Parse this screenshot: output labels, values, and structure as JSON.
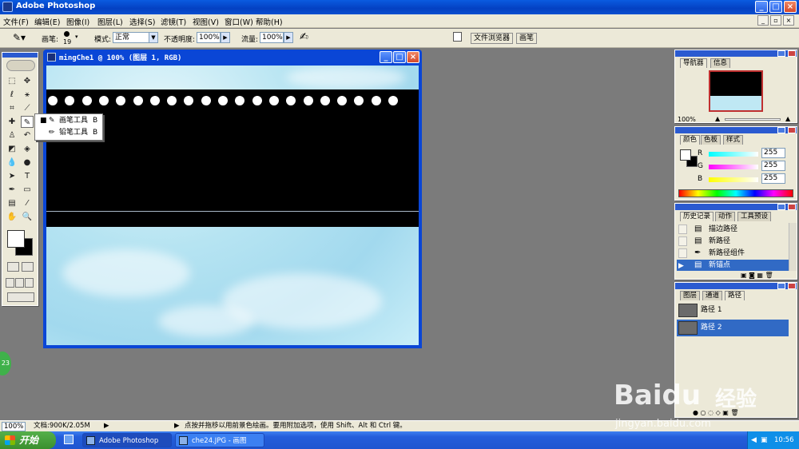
{
  "app": {
    "title": "Adobe Photoshop",
    "window_controls": {
      "minimize": "_",
      "maximize": "□",
      "close": "×"
    }
  },
  "menu": [
    "文件(F)",
    "编辑(E)",
    "图像(I)",
    "图层(L)",
    "选择(S)",
    "滤镜(T)",
    "视图(V)",
    "窗口(W)",
    "帮助(H)"
  ],
  "options_bar": {
    "brush_label": "画笔:",
    "brush_size": "19",
    "mode_label": "模式:",
    "mode_value": "正常",
    "opacity_label": "不透明度:",
    "opacity_value": "100%",
    "flow_label": "流量:",
    "flow_value": "100%",
    "tab_file_browser": "文件浏览器",
    "tab_brushes": "画笔"
  },
  "document": {
    "title": "mingChe1 @ 100% (图层 1, RGB)",
    "dot_count": 21
  },
  "tool_flyout": [
    {
      "name": "画笔工具",
      "key": "B",
      "bullet": "■",
      "selected": true
    },
    {
      "name": "铅笔工具",
      "key": "B",
      "bullet": "",
      "selected": false
    }
  ],
  "navigator_palette": {
    "tabs": [
      "导航器",
      "信息"
    ],
    "zoom": "100%"
  },
  "color_palette": {
    "tabs": [
      "颜色",
      "色板",
      "样式"
    ],
    "channels": [
      {
        "label": "R",
        "value": "255"
      },
      {
        "label": "G",
        "value": "255"
      },
      {
        "label": "B",
        "value": "255"
      }
    ]
  },
  "history_palette": {
    "tabs": [
      "历史记录",
      "动作",
      "工具预设"
    ],
    "items": [
      {
        "label": "描边路径",
        "icon": "history-step-icon",
        "selected": false
      },
      {
        "label": "新路径",
        "icon": "history-step-icon",
        "selected": false
      },
      {
        "label": "新路径组件",
        "icon": "pen-icon",
        "selected": false
      },
      {
        "label": "新锚点",
        "icon": "history-step-icon",
        "selected": true
      }
    ]
  },
  "paths_palette": {
    "tabs": [
      "图层",
      "通道",
      "路径"
    ],
    "items": [
      {
        "label": "路径 1",
        "selected": false
      },
      {
        "label": "路径 2",
        "selected": true
      }
    ]
  },
  "status_bar": {
    "zoom": "100%",
    "doc_info": "文档:900K/2.05M",
    "hint": "点按并拖移以用前景色绘画。要用附加选项，使用 Shift、Alt 和 Ctrl 键。"
  },
  "taskbar": {
    "start_label": "开始",
    "tasks": [
      {
        "label": "Adobe Photoshop",
        "active": true
      },
      {
        "label": "che24.JPG - 画图",
        "active": false
      }
    ],
    "clock": "10:56"
  },
  "watermark": {
    "brand": "Baidu",
    "brand_cn": "经验",
    "url": "jingyan.baidu.com"
  },
  "floating_badge": "23"
}
